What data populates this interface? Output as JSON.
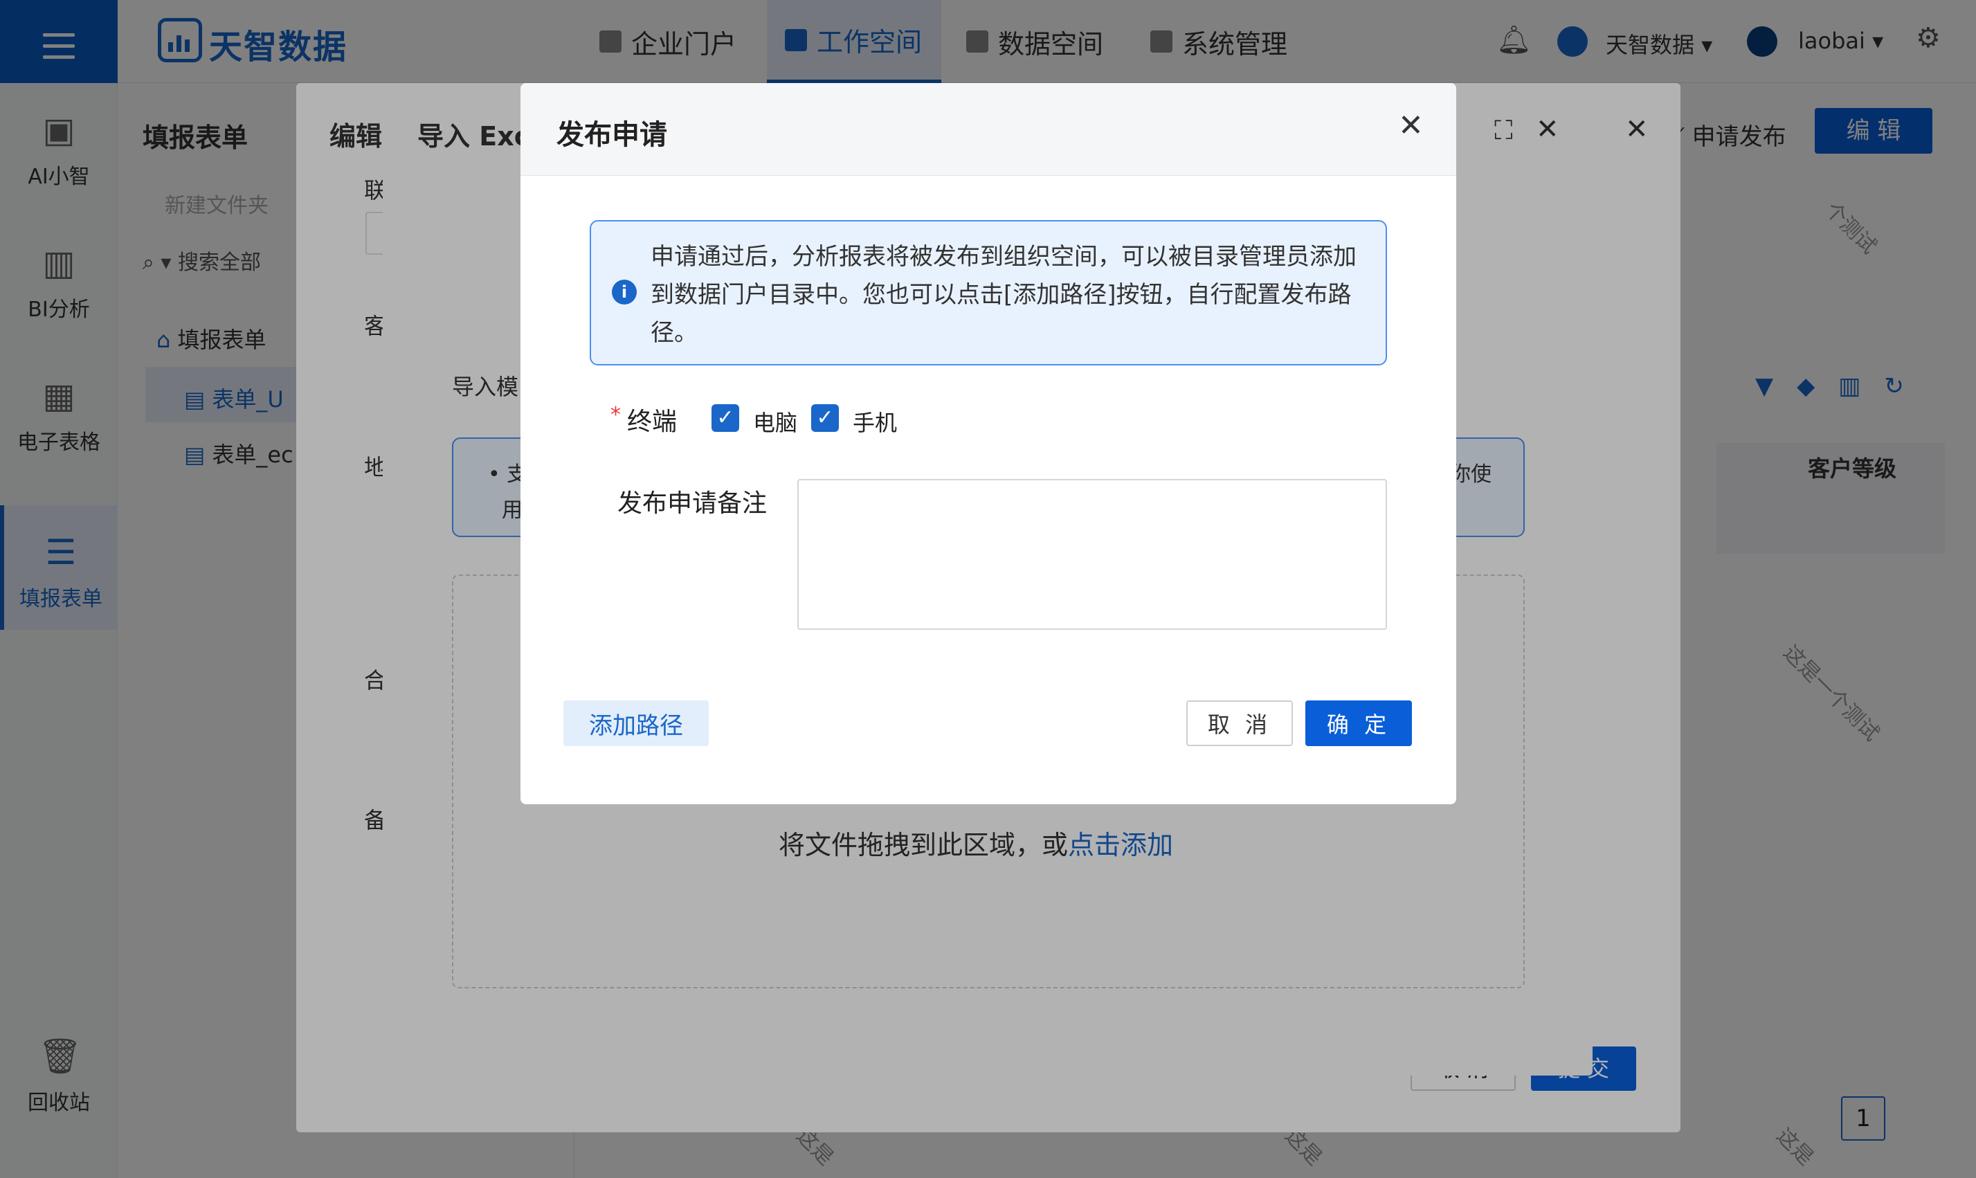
{
  "app": {
    "logo_text": "天智数据",
    "nav": [
      "企业门户",
      "工作空间",
      "数据空间",
      "系统管理"
    ],
    "org_name": "天智数据",
    "user_name": "laobai"
  },
  "sidebar": {
    "items": [
      {
        "label": "AI小智",
        "icon": "ai-assistant-icon"
      },
      {
        "label": "BI分析",
        "icon": "bi-chart-icon"
      },
      {
        "label": "电子表格",
        "icon": "spreadsheet-icon"
      },
      {
        "label": "填报表单",
        "icon": "form-icon"
      },
      {
        "label": "回收站",
        "icon": "trash-icon"
      }
    ]
  },
  "tree": {
    "title": "填报表单",
    "new_folder_placeholder": "新建文件夹",
    "search_placeholder": "搜索全部",
    "root": "填报表单",
    "nodes": [
      "表单_U",
      "表单_ec"
    ]
  },
  "toolbar": {
    "apply_publish": "申请发布",
    "edit": "编 辑",
    "column_header": "客户等级"
  },
  "edit_dialog": {
    "title": "编辑",
    "labels": [
      "联",
      "客",
      "地",
      "合",
      "备"
    ],
    "cancel": "取 消",
    "submit": "提 交"
  },
  "import_dialog": {
    "title": "导入 Excel",
    "template_label": "导入模",
    "tip_line1": "• 支",
    "tip_line2": "用",
    "tip_right": "你使",
    "drop_text": "将文件拖拽到此区域，或",
    "drop_link": "点击添加"
  },
  "publish_dialog": {
    "title": "发布申请",
    "info": "申请通过后，分析报表将被发布到组织空间，可以被目录管理员添加到数据门户目录中。您也可以点击[添加路径]按钮，自行配置发布路径。",
    "required_mark": "*",
    "terminal_label": "终端",
    "terminal_options": [
      {
        "label": "电脑",
        "checked": true
      },
      {
        "label": "手机",
        "checked": true
      }
    ],
    "note_label": "发布申请备注",
    "note_value": "",
    "add_path": "添加路径",
    "cancel": "取 消",
    "confirm": "确 定"
  },
  "pagination": {
    "current": "1"
  },
  "watermarks": [
    "个测试",
    "这是一个测试",
    "这是",
    "这是",
    "这是"
  ],
  "colors": {
    "primary": "#1a66c9",
    "button": "#0a5fd8",
    "info_bg": "#e8f2fe",
    "required": "#e53935"
  }
}
